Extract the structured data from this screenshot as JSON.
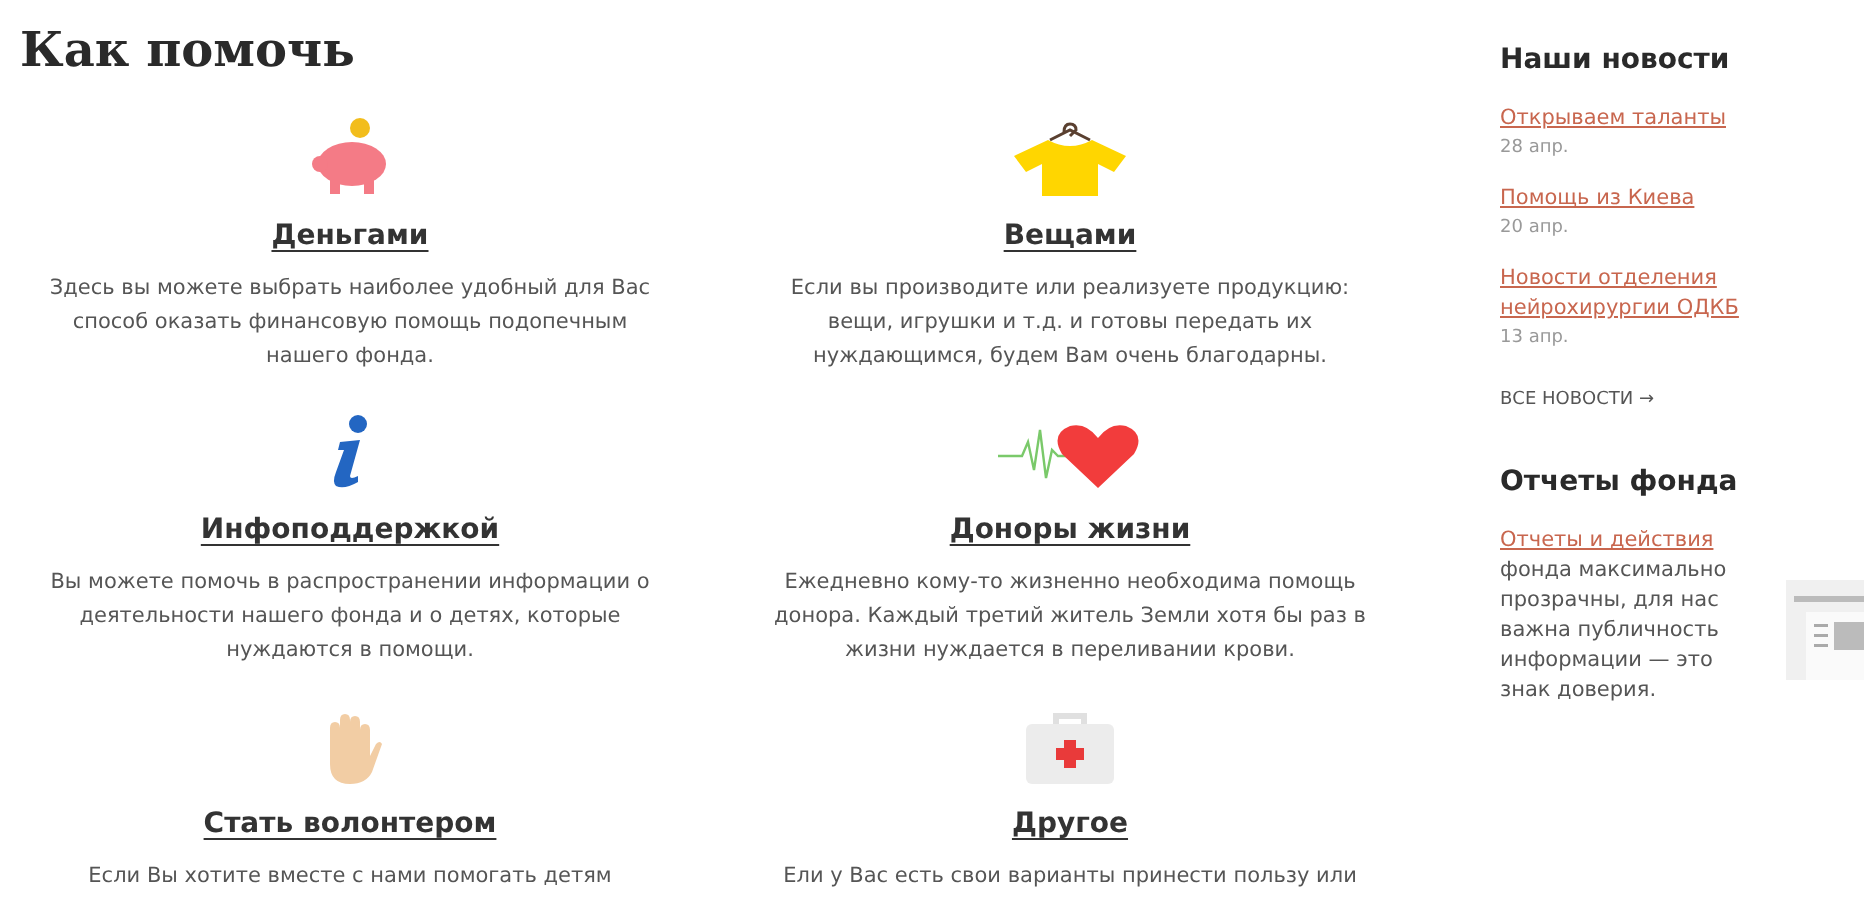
{
  "heading": "Как помочь",
  "ways": [
    {
      "title": "Деньгами",
      "description": "Здесь вы можете выбрать наиболее удобный для Вас способ оказать финансовую помощь подопечным нашего фонда."
    },
    {
      "title": "Вещами",
      "description": "Если вы производите или реализуете продукцию: вещи, игрушки и т.д. и готовы передать их нуждающимся, будем Вам очень благодарны."
    },
    {
      "title": "Инфоподдержкой",
      "description": "Вы можете помочь в распространении информации о деятельности нашего фонда и о детях, которые нуждаются в помощи."
    },
    {
      "title": "Доноры жизни",
      "description": "Ежедневно кому-то жизненно необходима помощь донора. Каждый третий житель Земли хотя бы раз в жизни нуждается в переливании крови."
    },
    {
      "title": "Стать волонтером",
      "description": "Если Вы хотите вместе с нами помогать детям"
    },
    {
      "title": "Другое",
      "description": "Ели у Вас есть свои варианты принести пользу или"
    }
  ],
  "news": {
    "title": "Наши новости",
    "items": [
      {
        "title": "Открываем таланты",
        "date": "28 апр."
      },
      {
        "title": "Помощь из Киева",
        "date": "20 апр."
      },
      {
        "title": "Новости отделения нейрохирургии ОДКБ",
        "date": "13 апр."
      }
    ],
    "all_link": "ВСЕ НОВОСТИ →"
  },
  "reports": {
    "title": "Отчеты фонда",
    "link": "Отчеты и действия",
    "text": "фонда максимально прозрачны, для нас важна публичность информации — это знак доверия."
  }
}
